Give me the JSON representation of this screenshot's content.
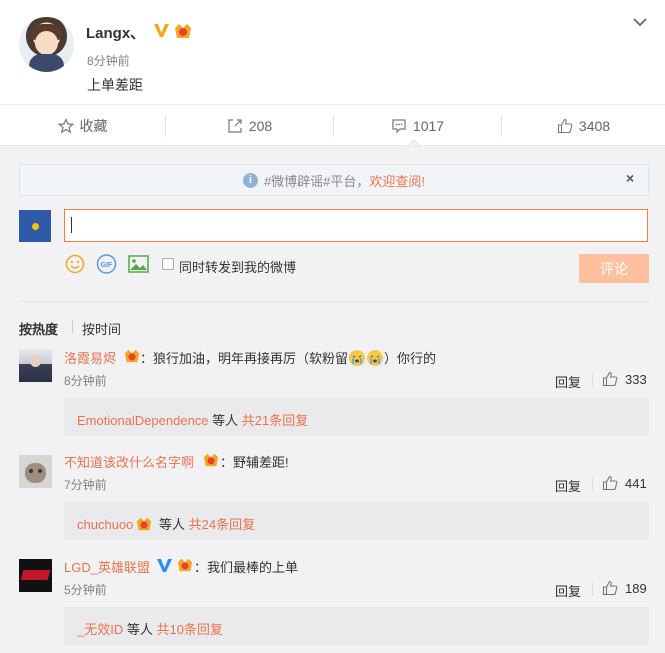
{
  "post": {
    "username": "Langx、",
    "time": "8分钟前",
    "text": "上单差距"
  },
  "actions": {
    "favorite": "收藏",
    "repost": "208",
    "comments": "1017",
    "likes": "3408"
  },
  "notice": {
    "prefix": "#微博辟谣#平台，",
    "link": "欢迎查阅!",
    "close": "×"
  },
  "composer": {
    "checkbox_label": "同时转发到我的微博",
    "submit_label": "评论",
    "gif_label": "GIF"
  },
  "sort": {
    "hot": "按热度",
    "time": "按时间"
  },
  "comments": [
    {
      "name": "洛霞易烬",
      "text_before": "：狼行加油，明年再接再厉（软粉留",
      "text_after": "）你行的",
      "time": "8分钟前",
      "reply": "回复",
      "likes": "333",
      "sub_user": "EmotionalDependence",
      "sub_mid": " 等人 ",
      "sub_count": "共21条回复"
    },
    {
      "name": "不知道该改什么名字啊",
      "text": "：野辅差距!",
      "time": "7分钟前",
      "reply": "回复",
      "likes": "441",
      "sub_user": "chuchuoo",
      "sub_mid": " 等人 ",
      "sub_count": "共24条回复"
    },
    {
      "name": "LGD_英雄联盟",
      "text": "：我们最棒的上单",
      "time": "5分钟前",
      "reply": "回复",
      "likes": "189",
      "sub_user": "_无效ID",
      "sub_mid": " 等人 ",
      "sub_count": "共10条回复"
    }
  ],
  "colors": {
    "accent": "#eb7350",
    "input_border": "#fa7d3c",
    "submit_disabled": "#ffc09f",
    "verified": "#f5a623"
  }
}
